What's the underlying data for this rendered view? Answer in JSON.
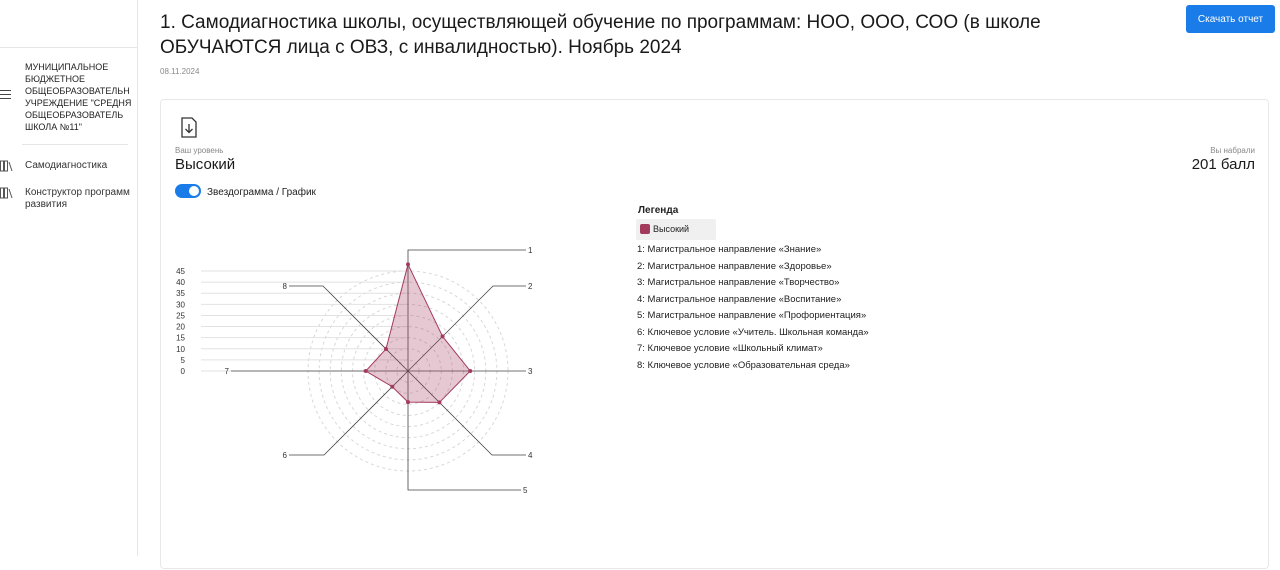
{
  "sidebar": {
    "org_lines": [
      "МУНИЦИПАЛЬНОЕ",
      "БЮДЖЕТНОЕ",
      "ОБЩЕОБРАЗОВАТЕЛЬН",
      "УЧРЕЖДЕНИЕ \"СРЕДНЯ",
      "ОБЩЕОБРАЗОВАТЕЛЬ",
      "ШКОЛА №11\""
    ],
    "nav": [
      {
        "label": "Самодиагностика",
        "icon": "books-icon"
      },
      {
        "label": "Конструктор программ развития",
        "icon": "books-icon"
      }
    ]
  },
  "header": {
    "title": "1. Самодиагностика школы, осуществляющей обучение по программам: НОО, ООО, СОО (в школе ОБУЧАЮТСЯ лица с ОВЗ, с инвалидностью). Ноябрь 2024",
    "date": "08.11.2024",
    "download_label": "Скачать отчет"
  },
  "result": {
    "level_caption": "Ваш уровень",
    "level_value": "Высокий",
    "score_caption": "Вы набрали",
    "score_value": "201 балл"
  },
  "toggle": {
    "label": "Звездограмма / График",
    "on": true
  },
  "legend": {
    "title": "Легенда",
    "series_label": "Высокий",
    "axes": [
      "1: Магистральное направление «Знание»",
      "2: Магистральное направление «Здоровье»",
      "3: Магистральное направление «Творчество»",
      "4: Магистральное направление «Воспитание»",
      "5: Магистральное направление «Профориентация»",
      "6: Ключевое условие «Учитель. Школьная команда»",
      "7: Ключевое условие «Школьный климат»",
      "8: Ключевое условие «Образовательная среда»"
    ]
  },
  "chart_data": {
    "type": "radar",
    "axes": [
      "1",
      "2",
      "3",
      "4",
      "5",
      "6",
      "7",
      "8"
    ],
    "scale_ticks": [
      0,
      5,
      10,
      15,
      20,
      25,
      30,
      35,
      40,
      45
    ],
    "rmax": 45,
    "series": [
      {
        "name": "Высокий",
        "color": "#a33b5c",
        "values": [
          48,
          22,
          28,
          20,
          14,
          10,
          19,
          14
        ]
      }
    ],
    "grid": true
  }
}
